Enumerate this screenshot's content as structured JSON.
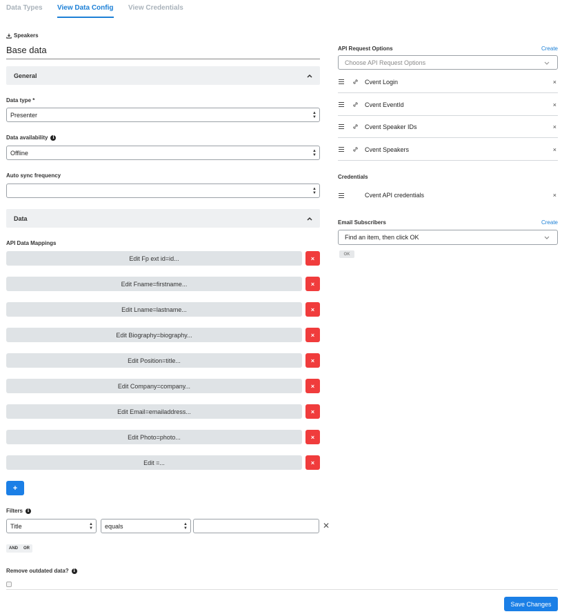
{
  "tabs": [
    {
      "label": "Data Types"
    },
    {
      "label": "View Data Config"
    },
    {
      "label": "View Credentials"
    }
  ],
  "header": {
    "entity": "Speakers",
    "title": "Base data"
  },
  "general": {
    "title": "General",
    "data_type_label": "Data type *",
    "data_type_value": "Presenter",
    "availability_label": "Data availability",
    "availability_value": "Offline",
    "sync_label": "Auto sync frequency",
    "sync_value": ""
  },
  "data_section": {
    "title": "Data",
    "mappings_label": "API Data Mappings",
    "mappings": [
      {
        "label": "Edit Fp ext id=id..."
      },
      {
        "label": "Edit Fname=firstname..."
      },
      {
        "label": "Edit Lname=lastname..."
      },
      {
        "label": "Edit Biography=biography..."
      },
      {
        "label": "Edit Position=title..."
      },
      {
        "label": "Edit Company=company..."
      },
      {
        "label": "Edit Email=emailaddress..."
      },
      {
        "label": "Edit Photo=photo..."
      },
      {
        "label": "Edit =..."
      }
    ],
    "delete_glyph": "×",
    "add_glyph": "+"
  },
  "filters": {
    "label": "Filters",
    "field_value": "Title",
    "operator_value": "equals",
    "input_value": "",
    "remove_glyph": "✕",
    "and_label": "AND",
    "or_label": "OR"
  },
  "remove_outdated": {
    "label": "Remove outdated data?",
    "checked": false
  },
  "footer": {
    "save_label": "Save Changes"
  },
  "api_request_options": {
    "label": "API Request Options",
    "create_label": "Create",
    "placeholder": "Choose API Request Options",
    "items": [
      {
        "label": "Cvent Login"
      },
      {
        "label": "Cvent EventId"
      },
      {
        "label": "Cvent Speaker IDs"
      },
      {
        "label": "Cvent Speakers"
      }
    ]
  },
  "credentials": {
    "label": "Credentials",
    "items": [
      {
        "label": "Cvent API credentials"
      }
    ]
  },
  "email_subscribers": {
    "label": "Email Subscribers",
    "create_label": "Create",
    "placeholder": "Find an item, then click OK",
    "ok_label": "OK"
  },
  "remove_glyph": "×",
  "colors": {
    "accent": "#1b7fd6",
    "danger": "#f03c3c",
    "section_bg": "#eef0f2",
    "mapping_bg": "#dfe3e6"
  },
  "icons": {
    "entity": "download-icon",
    "info": "info-icon",
    "caret": "chevron-up-icon",
    "drag": "drag-handle-icon",
    "link": "link-icon"
  }
}
